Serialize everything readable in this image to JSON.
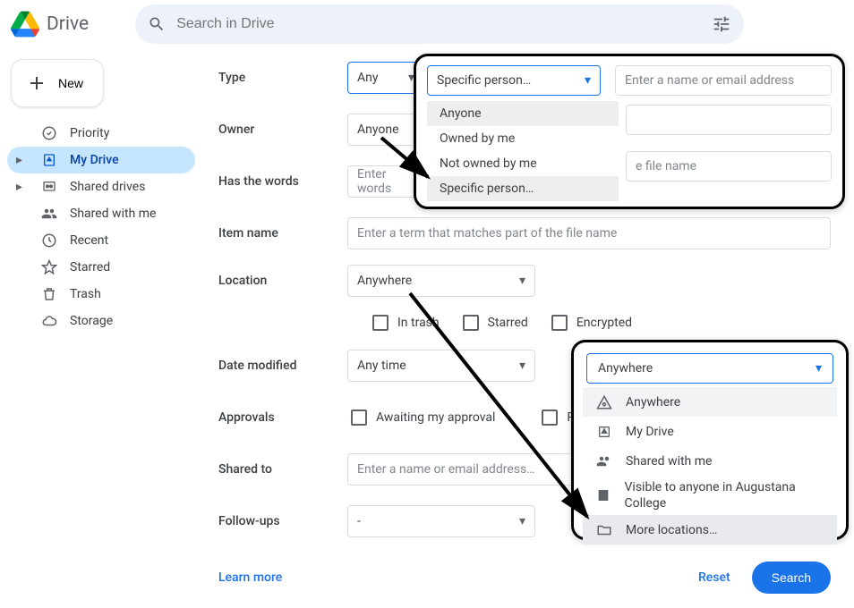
{
  "app": {
    "name": "Drive",
    "search_placeholder": "Search in Drive"
  },
  "sidebar": {
    "new_label": "New",
    "items": [
      {
        "label": "Priority"
      },
      {
        "label": "My Drive"
      },
      {
        "label": "Shared drives"
      },
      {
        "label": "Shared with me"
      },
      {
        "label": "Recent"
      },
      {
        "label": "Starred"
      },
      {
        "label": "Trash"
      },
      {
        "label": "Storage"
      }
    ]
  },
  "form": {
    "type": {
      "label": "Type",
      "value": "Any"
    },
    "owner": {
      "label": "Owner",
      "value": "Anyone"
    },
    "has_words": {
      "label": "Has the words",
      "placeholder": "Enter words"
    },
    "item_name": {
      "label": "Item name",
      "placeholder": "Enter a term that matches part of the file name"
    },
    "location": {
      "label": "Location",
      "value": "Anywhere",
      "checks": {
        "in_trash": "In trash",
        "starred": "Starred",
        "encrypted": "Encrypted"
      }
    },
    "date_modified": {
      "label": "Date modified",
      "value": "Any time"
    },
    "approvals": {
      "label": "Approvals",
      "awaiting": "Awaiting my approval",
      "requested": "Requested"
    },
    "shared_to": {
      "label": "Shared to",
      "placeholder": "Enter a name or email address…"
    },
    "followups": {
      "label": "Follow-ups",
      "value": "-"
    }
  },
  "footer": {
    "learn": "Learn more",
    "reset": "Reset",
    "search": "Search"
  },
  "callout_owner": {
    "select_value": "Specific person…",
    "name_placeholder": "Enter a name or email address",
    "file_fragment": "e file name",
    "options": [
      {
        "label": "Anyone"
      },
      {
        "label": "Owned by me"
      },
      {
        "label": "Not owned by me"
      },
      {
        "label": "Specific person…"
      }
    ]
  },
  "callout_location": {
    "select_value": "Anywhere",
    "options": [
      {
        "label": "Anywhere"
      },
      {
        "label": "My Drive"
      },
      {
        "label": "Shared with me"
      },
      {
        "label": "Visible to anyone in Augustana College"
      },
      {
        "label": "More locations…"
      }
    ]
  }
}
